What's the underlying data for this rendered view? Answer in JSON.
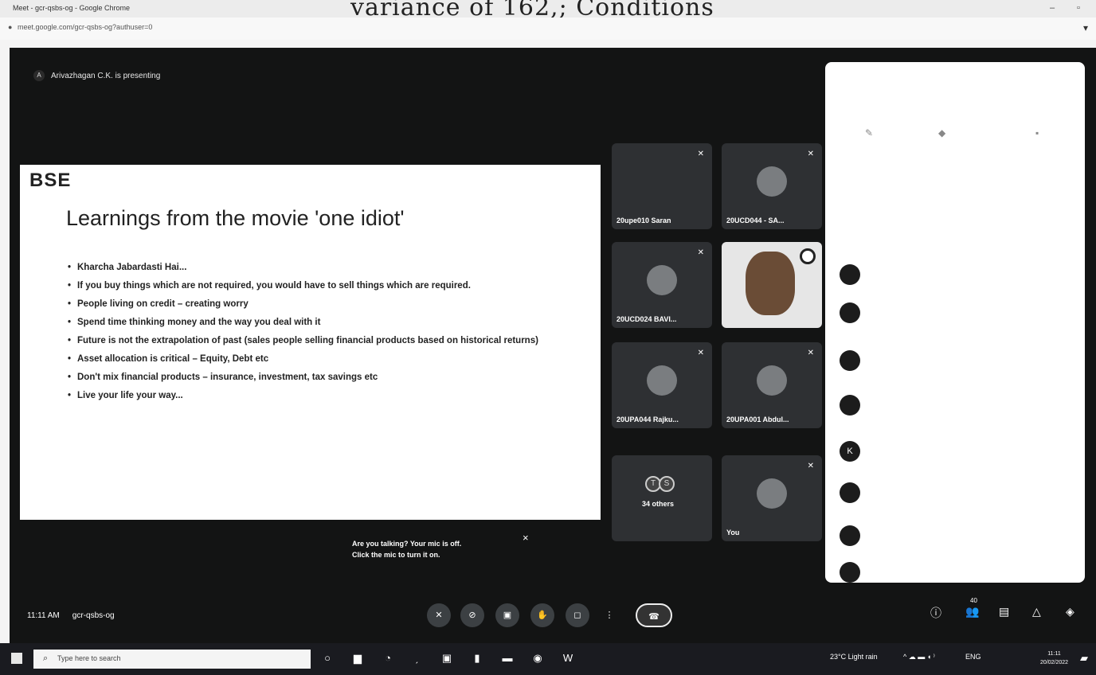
{
  "window": {
    "title": "Meet - gcr-qsbs-og - Google Chrome",
    "url": "meet.google.com/gcr-qsbs-og?authuser=0",
    "watermark": "variance of 162,; Conditions"
  },
  "meet": {
    "presenting_text": "Arivazhagan C.K. is presenting",
    "slide": {
      "logo": "BSE",
      "title": "Learnings from the movie 'one idiot'",
      "bullets": [
        "Kharcha Jabardasti Hai...",
        "If you buy things which are not required, you would have to sell things which are required.",
        "People living on credit – creating worry",
        "Spend time thinking money and the way you deal with it",
        "Future is not the extrapolation of past (sales people selling financial products based on historical returns)",
        "Asset allocation is critical – Equity, Debt etc",
        "Don't mix financial products – insurance, investment, tax savings etc",
        "Live your life your way..."
      ]
    },
    "participants": [
      {
        "name": "20upe010 Saran"
      },
      {
        "name": "20UCD044 - SA..."
      },
      {
        "name": "20UCD024 BAVI..."
      },
      {
        "name": ""
      },
      {
        "name": "20UPA044 Rajku..."
      },
      {
        "name": "20UPA001 Abdul..."
      },
      {
        "name": "34 others"
      },
      {
        "name": "You"
      }
    ],
    "others_initials": [
      "T",
      "S"
    ],
    "toast": {
      "line1": "Are you talking? Your mic is off.",
      "line2": "Click the mic to turn it on.",
      "close": "×"
    },
    "bottom_bar": {
      "time": "11:11 AM",
      "meeting_code": "gcr-qsbs-og",
      "participants_badge": "40"
    },
    "panel_avatars": [
      "",
      "",
      "",
      "",
      "K",
      "",
      "",
      ""
    ]
  },
  "taskbar": {
    "search_placeholder": "Type here to search",
    "weather": "23°C Light rain",
    "lang": "ENG",
    "time": "11:11",
    "date": "20/02/2022"
  }
}
